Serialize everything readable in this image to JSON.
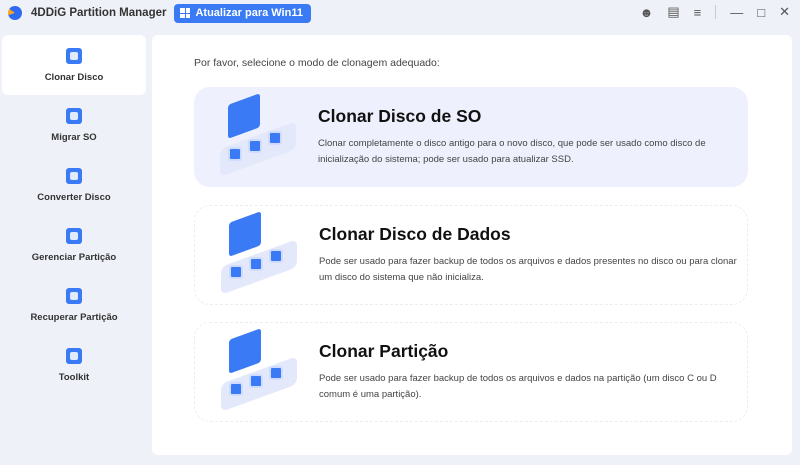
{
  "app": {
    "title": "4DDiG Partition Manager",
    "upgrade_label": "Atualizar para Win11"
  },
  "sidebar": {
    "items": [
      {
        "label": "Clonar Disco",
        "active": true
      },
      {
        "label": "Migrar SO"
      },
      {
        "label": "Converter Disco"
      },
      {
        "label": "Gerenciar Partição"
      },
      {
        "label": "Recuperar Partição"
      },
      {
        "label": "Toolkit"
      }
    ]
  },
  "main": {
    "prompt": "Por favor, selecione o modo de clonagem adequado:",
    "cards": [
      {
        "title": "Clonar Disco de SO",
        "desc": "Clonar completamente o disco antigo para o novo disco, que pode ser usado como disco de inicialização do sistema; pode ser usado para atualizar SSD."
      },
      {
        "title": "Clonar Disco de Dados",
        "desc": "Pode ser usado para fazer backup de todos os arquivos e dados presentes no disco ou para clonar um disco do sistema que não inicializa."
      },
      {
        "title": "Clonar Partição",
        "desc": "Pode ser usado para fazer backup de todos os arquivos e dados na partição (um disco C ou D comum é uma partição)."
      }
    ]
  }
}
